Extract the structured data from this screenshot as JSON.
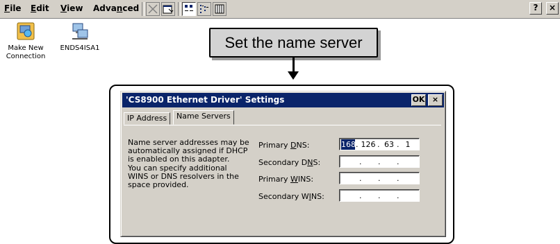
{
  "menubar": {
    "items": [
      {
        "label": "File",
        "accel": "F",
        "rest": "ile"
      },
      {
        "label": "Edit",
        "accel": "E",
        "rest": "dit"
      },
      {
        "label": "View",
        "accel": "V",
        "rest": "iew"
      },
      {
        "label": "Advanced",
        "pre": "Adva",
        "accel": "n",
        "rest": "ced"
      }
    ],
    "toolbar_icons": [
      "delete-icon",
      "properties-icon",
      "large-icons-view-icon",
      "small-icons-view-icon",
      "details-view-icon"
    ],
    "help_label": "?",
    "close_label": "×"
  },
  "desktop": {
    "icons": [
      {
        "label_line1": "Make New",
        "label_line2": "Connection"
      },
      {
        "label_line1": "ENDS4ISA1",
        "label_line2": ""
      }
    ]
  },
  "callout": {
    "text": "Set the name server"
  },
  "dialog": {
    "title": "'CS8900 Ethernet Driver' Settings",
    "ok_label": "OK",
    "close_label": "×",
    "tabs": [
      "IP Address",
      "Name Servers"
    ],
    "active_tab": "Name Servers",
    "description_lines": [
      "Name server addresses may be",
      "automatically assigned if DHCP",
      "is enabled on this adapter.",
      "You can specify additional",
      "WINS or DNS resolvers in the",
      "space provided."
    ],
    "fields": [
      {
        "pre": "Primary ",
        "accel": "D",
        "post": "NS:",
        "value": [
          "168",
          "126",
          "63",
          "1"
        ]
      },
      {
        "pre": "Secondary D",
        "accel": "N",
        "post": "S:",
        "value": [
          "",
          "",
          "",
          ""
        ]
      },
      {
        "pre": "Primary ",
        "accel": "W",
        "post": "INS:",
        "value": [
          "",
          "",
          "",
          ""
        ]
      },
      {
        "pre": "Secondary W",
        "accel": "I",
        "post": "NS:",
        "value": [
          "",
          "",
          "",
          ""
        ]
      }
    ]
  },
  "colors": {
    "titlebar": "#0a246a",
    "face": "#d4d0c8",
    "callout_fill": "#d3d3d3"
  }
}
